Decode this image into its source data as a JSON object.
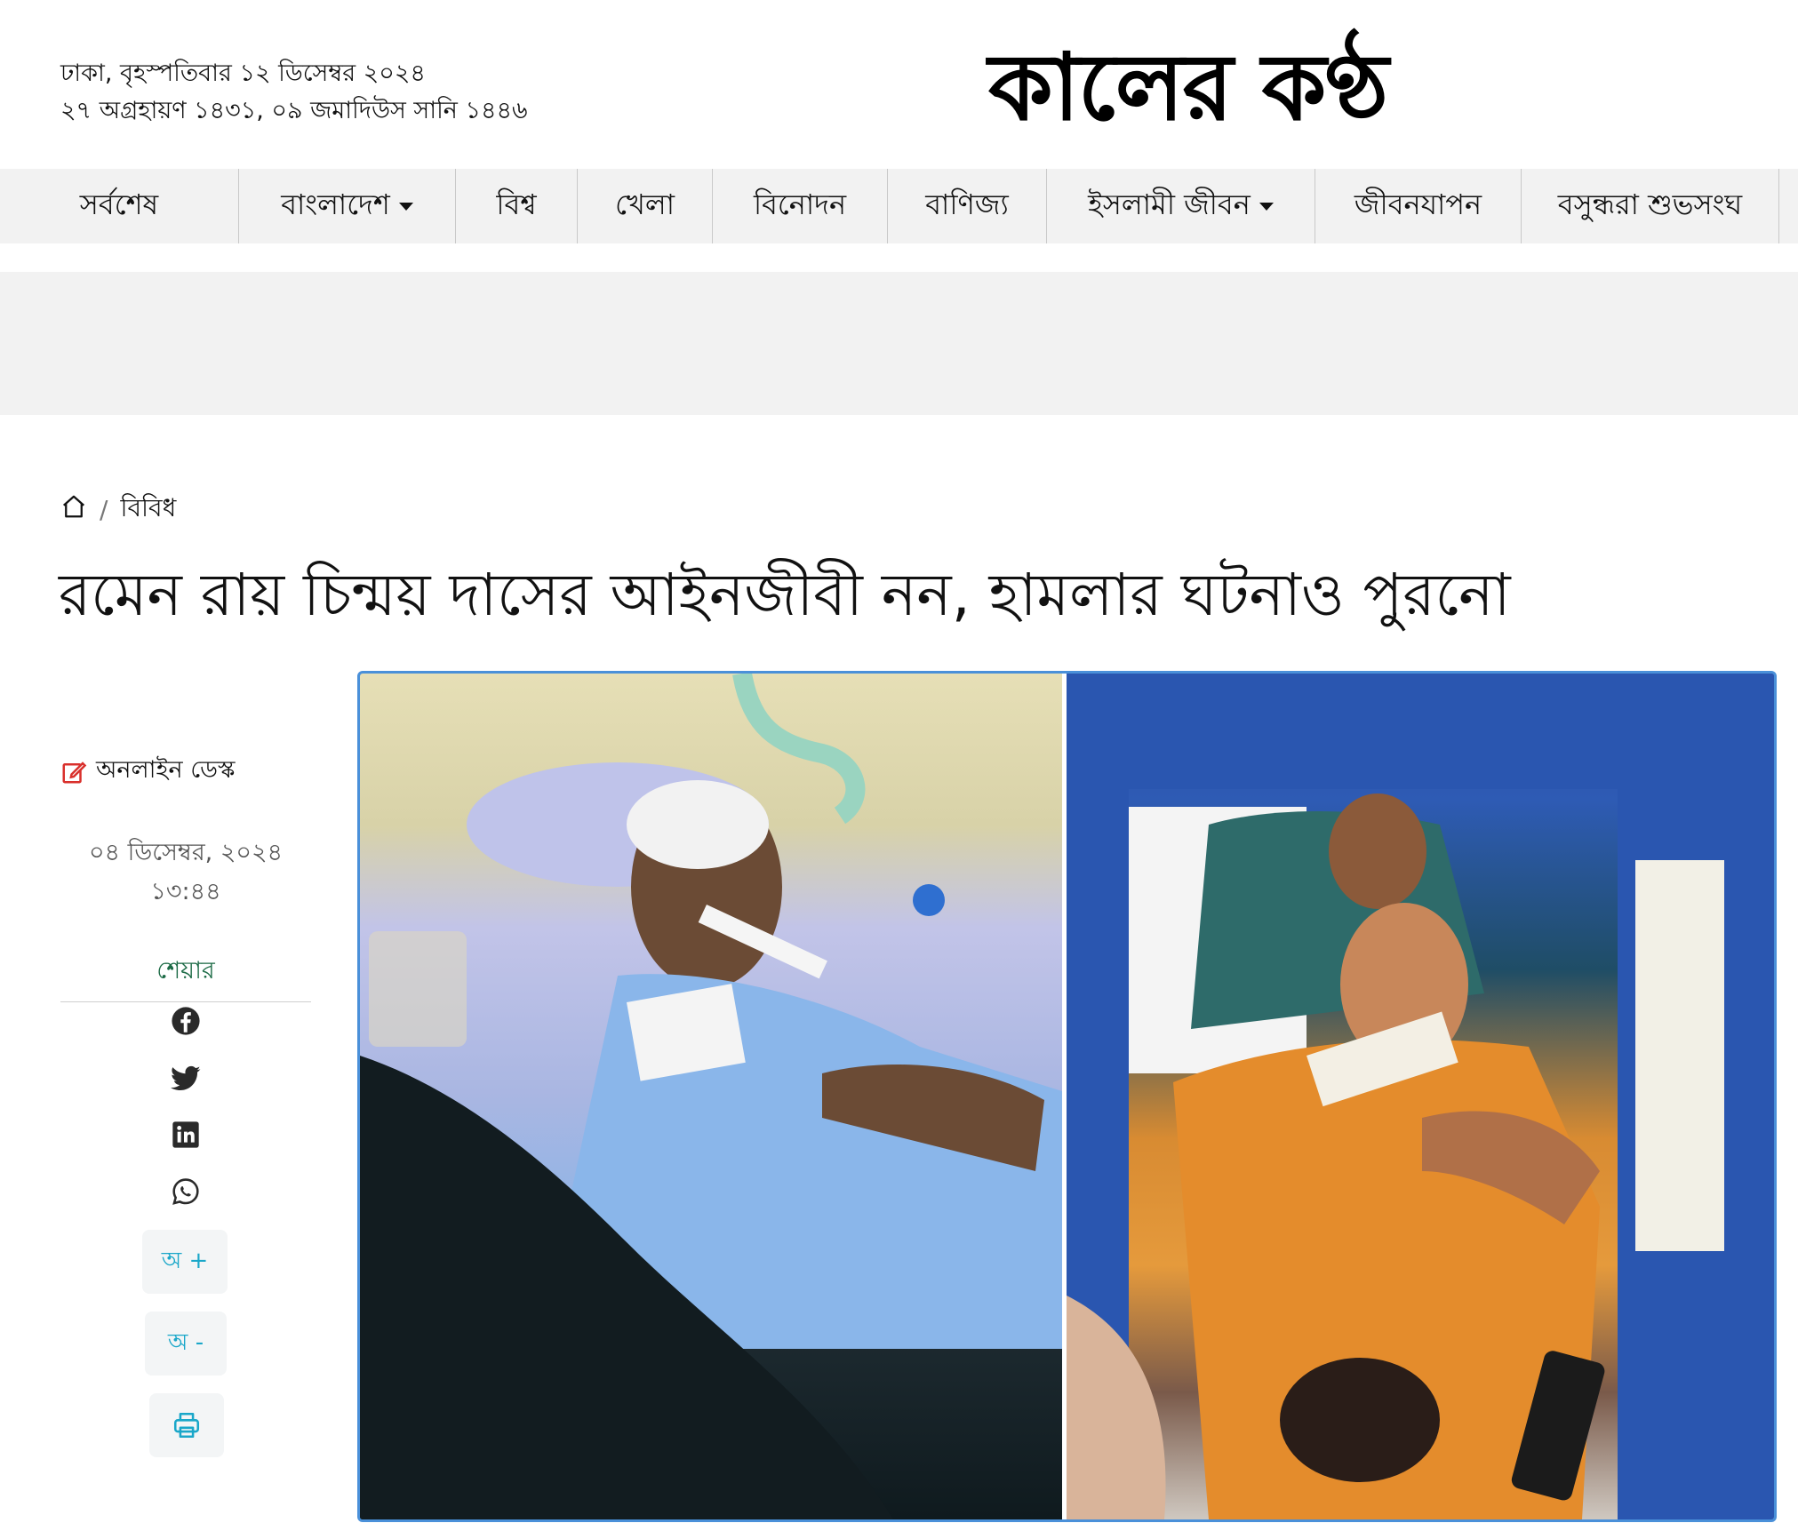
{
  "header": {
    "date_line1": "ঢাকা, বৃহস্পতিবার ১২ ডিসেম্বর ২০২৪",
    "date_line2": "২৭ অগ্রহায়ণ ১৪৩১, ০৯ জমাদিউস সানি ১৪৪৬",
    "logo_text": "কালের কণ্ঠ"
  },
  "nav": {
    "items": [
      {
        "label": "সর্বশেষ",
        "dropdown": false
      },
      {
        "label": "বাংলাদেশ",
        "dropdown": true
      },
      {
        "label": "বিশ্ব",
        "dropdown": false
      },
      {
        "label": "খেলা",
        "dropdown": false
      },
      {
        "label": "বিনোদন",
        "dropdown": false
      },
      {
        "label": "বাণিজ্য",
        "dropdown": false
      },
      {
        "label": "ইসলামী জীবন",
        "dropdown": true
      },
      {
        "label": "জীবনযাপন",
        "dropdown": false
      },
      {
        "label": "বসুন্ধরা শুভসংঘ",
        "dropdown": false
      }
    ]
  },
  "breadcrumb": {
    "home_icon": "home-icon",
    "separator": "/",
    "category": "বিবিধ"
  },
  "article": {
    "headline": "রমেন রায় চিন্ময় দাসের আইনজীবী নন, হামলার ঘটনাও পুরনো",
    "author": "অনলাইন ডেস্ক",
    "date": "০৪ ডিসেম্বর, ২০২৪",
    "time": "১৩:৪৪"
  },
  "share": {
    "label": "শেয়ার",
    "icons": [
      "facebook-icon",
      "twitter-icon",
      "linkedin-icon",
      "whatsapp-icon"
    ],
    "font_increase": "অ +",
    "font_decrease": "অ -",
    "print_icon": "print-icon"
  },
  "colors": {
    "nav_bg": "#f2f2f2",
    "share_label": "#1b6a45",
    "tool_accent": "#1aa7c9",
    "photo_border": "#4a90d9",
    "author_icon": "#d9302c"
  }
}
